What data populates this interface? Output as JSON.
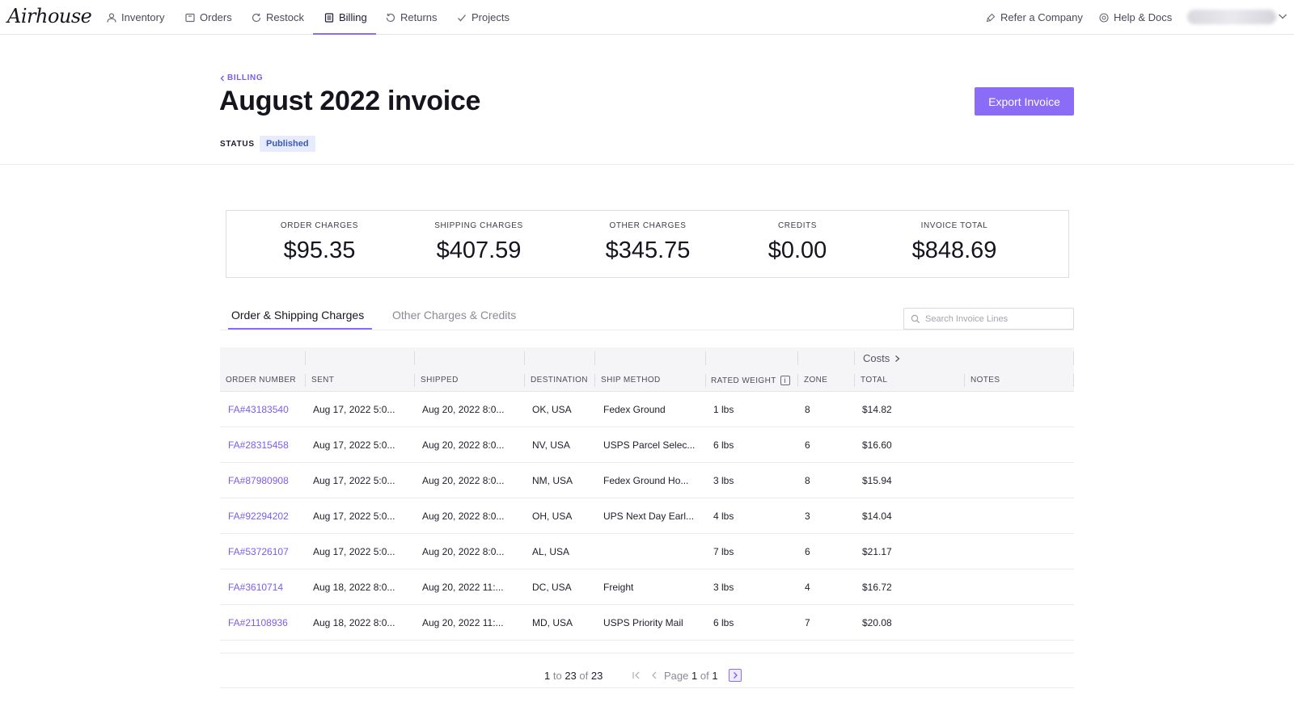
{
  "brand": {
    "logo_text": "Airhouse",
    "accent": "#8b6cf6"
  },
  "nav": {
    "items": [
      {
        "label": "Inventory",
        "icon": "person-icon"
      },
      {
        "label": "Orders",
        "icon": "package-icon"
      },
      {
        "label": "Restock",
        "icon": "refresh-icon"
      },
      {
        "label": "Billing",
        "icon": "receipt-icon",
        "active": true
      },
      {
        "label": "Returns",
        "icon": "return-icon"
      },
      {
        "label": "Projects",
        "icon": "check-icon"
      }
    ],
    "refer": "Refer a Company",
    "help": "Help & Docs"
  },
  "header": {
    "breadcrumb": "BILLING",
    "title": "August 2022 invoice",
    "export_label": "Export Invoice",
    "status_label": "STATUS",
    "status_value": "Published"
  },
  "summary": [
    {
      "label": "ORDER CHARGES",
      "value": "$95.35"
    },
    {
      "label": "SHIPPING CHARGES",
      "value": "$407.59"
    },
    {
      "label": "OTHER CHARGES",
      "value": "$345.75"
    },
    {
      "label": "CREDITS",
      "value": "$0.00"
    },
    {
      "label": "INVOICE TOTAL",
      "value": "$848.69"
    }
  ],
  "tabs": [
    {
      "label": "Order & Shipping Charges",
      "active": true
    },
    {
      "label": "Other Charges & Credits",
      "active": false
    }
  ],
  "search": {
    "placeholder": "Search Invoice Lines",
    "value": ""
  },
  "table": {
    "group_label": "Costs",
    "columns": [
      "ORDER NUMBER",
      "SENT",
      "SHIPPED",
      "DESTINATION",
      "SHIP METHOD",
      "RATED WEIGHT",
      "ZONE",
      "TOTAL",
      "NOTES"
    ],
    "rows": [
      [
        "FA#43183540",
        "Aug 17, 2022 5:0...",
        "Aug 20, 2022 8:0...",
        "OK, USA",
        "Fedex Ground",
        "1 lbs",
        "8",
        "$14.82",
        ""
      ],
      [
        "FA#28315458",
        "Aug 17, 2022 5:0...",
        "Aug 20, 2022 8:0...",
        "NV, USA",
        "USPS Parcel Selec...",
        "6 lbs",
        "6",
        "$16.60",
        ""
      ],
      [
        "FA#87980908",
        "Aug 17, 2022 5:0...",
        "Aug 20, 2022 8:0...",
        "NM, USA",
        "Fedex Ground Ho...",
        "3 lbs",
        "8",
        "$15.94",
        ""
      ],
      [
        "FA#92294202",
        "Aug 17, 2022 5:0...",
        "Aug 20, 2022 8:0...",
        "OH, USA",
        "UPS Next Day Earl...",
        "4 lbs",
        "3",
        "$14.04",
        ""
      ],
      [
        "FA#53726107",
        "Aug 17, 2022 5:0...",
        "Aug 20, 2022 8:0...",
        "AL, USA",
        "",
        "7 lbs",
        "6",
        "$21.17",
        ""
      ],
      [
        "FA#3610714",
        "Aug 18, 2022 8:0...",
        "Aug 20, 2022 11:...",
        "DC, USA",
        "Freight",
        "3 lbs",
        "4",
        "$16.72",
        ""
      ],
      [
        "FA#21108936",
        "Aug 18, 2022 8:0...",
        "Aug 20, 2022 11:...",
        "MD, USA",
        "USPS Priority Mail",
        "6 lbs",
        "7",
        "$20.08",
        ""
      ]
    ]
  },
  "pagination": {
    "from": "1",
    "to_word": "to",
    "to": "23",
    "of_word": "of",
    "total": "23",
    "page_word": "Page",
    "page": "1",
    "of_word2": "of",
    "pages": "1"
  }
}
